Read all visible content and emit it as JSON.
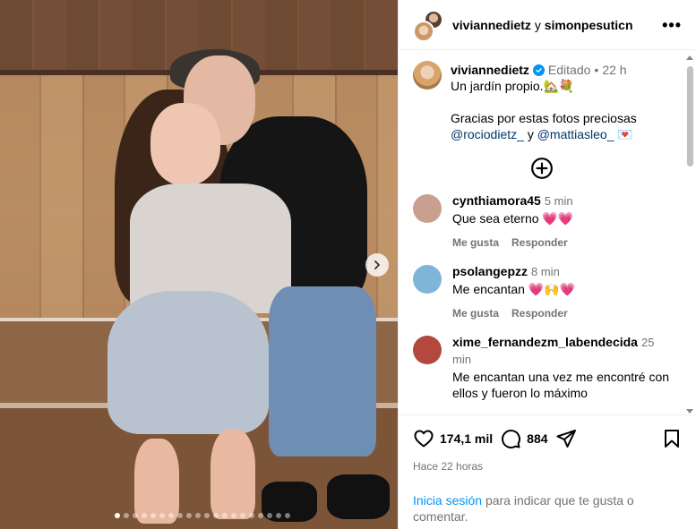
{
  "post": {
    "dots_total": 20,
    "dots_active": 0
  },
  "header": {
    "user1": "viviannedietz",
    "joiner": "y",
    "user2": "simonpesuticn",
    "more": "•••"
  },
  "caption": {
    "username": "viviannedietz",
    "edited": "Editado",
    "bullet": "•",
    "time": "22 h",
    "line1": "Un jardín propio.🏡💐",
    "line2": "Gracias por estas fotos preciosas",
    "mention1": "@rociodietz_",
    "and": "y",
    "mention2": "@mattiasleo_",
    "emoji_end": "💌"
  },
  "comments": [
    {
      "user": "cynthiamora45",
      "time": "5 min",
      "text": "Que sea eterno 💗💗",
      "like": "Me gusta",
      "reply": "Responder",
      "avatar_color": "#c9a090"
    },
    {
      "user": "psolangepzz",
      "time": "8 min",
      "text": "Me encantan 💗🙌💗",
      "like": "Me gusta",
      "reply": "Responder",
      "avatar_color": "#7fb6d8"
    },
    {
      "user": "xime_fernandezm_labendecida",
      "time": "25 min",
      "text": "Me encantan una vez me encontré con ellos y fueron lo máximo",
      "avatar_color": "#b3483f"
    }
  ],
  "stats": {
    "likes": "174,1 mil",
    "comments": "884"
  },
  "time_ago": "Hace 22 horas",
  "login": {
    "link": "Inicia sesión",
    "rest": "para indicar que te gusta o comentar."
  }
}
